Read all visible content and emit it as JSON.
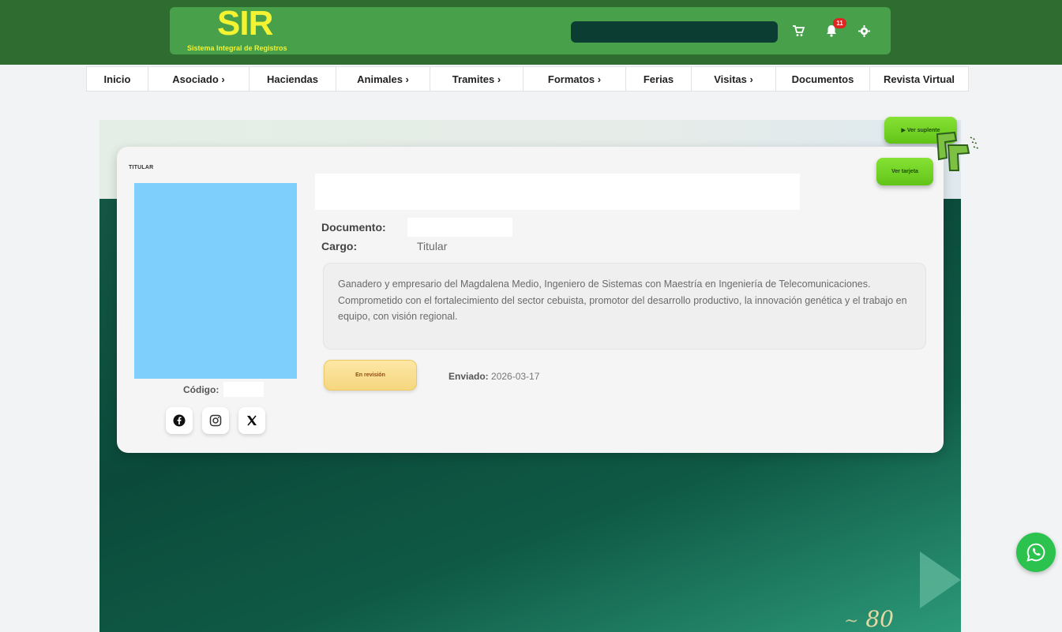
{
  "header": {
    "logo_main": "SIR",
    "logo_sub": "Sistema Integral de Registros",
    "search_value": "",
    "notification_count": "11",
    "icons": [
      "cart-icon",
      "bell-icon",
      "gear-icon"
    ]
  },
  "nav": {
    "items": [
      {
        "label": "Inicio"
      },
      {
        "label": "Asociado ›"
      },
      {
        "label": "Haciendas"
      },
      {
        "label": "Animales ›"
      },
      {
        "label": "Tramites ›"
      },
      {
        "label": "Formatos ›"
      },
      {
        "label": "Ferias"
      },
      {
        "label": "Visitas ›"
      },
      {
        "label": "Documentos"
      },
      {
        "label": "Revista Virtual"
      }
    ]
  },
  "actions": {
    "ver_suplente": "▶ Ver suplente",
    "ver_tarjeta": "Ver tarjeta"
  },
  "card": {
    "tag": "TITULAR",
    "documento_label": "Documento:",
    "documento_value": "",
    "cargo_label": "Cargo:",
    "cargo_value": "Titular",
    "bio": "Ganadero y empresario del Magdalena Medio, Ingeniero de Sistemas con Maestría en Ingeniería de Telecomunicaciones. Comprometido con el fortalecimiento del sector cebuista, promotor del desarrollo productivo, la innovación genética y el trabajo en equipo, con visión regional.",
    "status": "En revisión",
    "enviado_label": "Enviado:",
    "enviado_value": "2026-03-17",
    "codigo_label": "Código:",
    "codigo_value": "",
    "social": [
      "facebook-icon",
      "instagram-icon",
      "x-icon"
    ]
  },
  "footer_logo": "80",
  "colors": {
    "header_dark": "#2e6d2f",
    "header_light": "#48a04a",
    "logo_yellow": "#f3f233",
    "accent_green": "#6fd22a",
    "whatsapp": "#2bc24e"
  }
}
